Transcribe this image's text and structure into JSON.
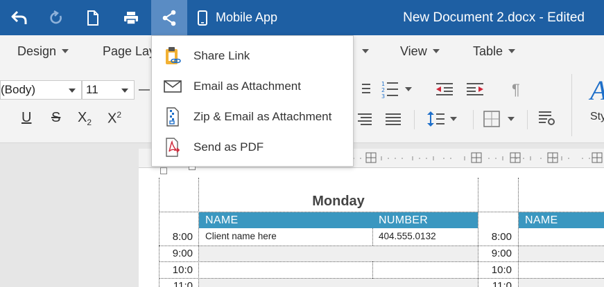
{
  "titlebar": {
    "mobile_app_label": "Mobile App",
    "document_title": "New Document 2.docx - Edited",
    "color": "#1e5fa3"
  },
  "menu": {
    "tabs": [
      {
        "label": "Design"
      },
      {
        "label": "Page Lay"
      },
      {
        "label": "View"
      },
      {
        "label": "Table"
      }
    ]
  },
  "ribbon": {
    "font_name": "(Body)",
    "font_size": "11",
    "styles_label": "Sty",
    "format_buttons": {
      "underline": "U",
      "strikethrough": "S",
      "subscript_base": "X",
      "subscript_mark": "2",
      "superscript_base": "X",
      "superscript_mark": "2",
      "pilcrow": "¶"
    }
  },
  "share_menu": {
    "items": [
      {
        "label": "Share Link",
        "icon": "share-link-icon"
      },
      {
        "label": "Email as Attachment",
        "icon": "email-icon"
      },
      {
        "label": "Zip & Email as Attachment",
        "icon": "zip-icon"
      },
      {
        "label": "Send as PDF",
        "icon": "pdf-icon"
      }
    ]
  },
  "document": {
    "day_title": "Monday",
    "header": {
      "name": "NAME",
      "number": "NUMBER",
      "name_right": "NAME"
    },
    "header_color": "#3a97c0",
    "rows": [
      {
        "time": "8:00",
        "name": "Client name here",
        "number": "404.555.0132",
        "time_right": "8:00"
      },
      {
        "time": "9:00",
        "name": "",
        "number": "",
        "time_right": "9:00"
      },
      {
        "time": "10:0",
        "name": "",
        "number": "",
        "time_right": "10:0"
      },
      {
        "time": "11:0",
        "name": "",
        "number": "",
        "time_right": "11:0"
      }
    ]
  }
}
